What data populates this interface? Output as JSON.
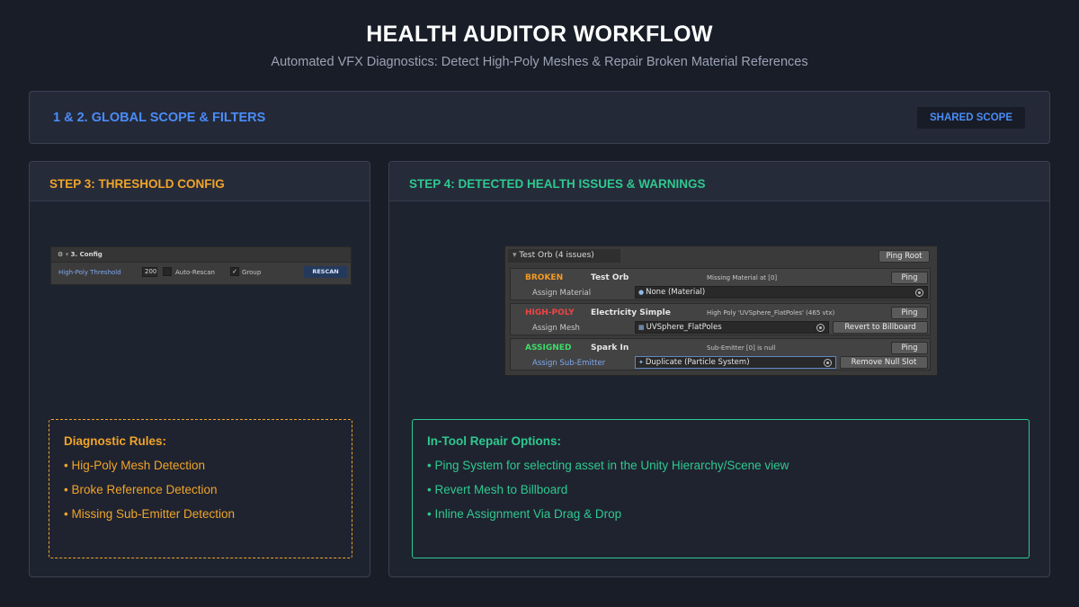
{
  "header": {
    "title": "HEALTH AUDITOR WORKFLOW",
    "subtitle": "Automated VFX Diagnostics: Detect High-Poly Meshes & Repair Broken Material References"
  },
  "scope": {
    "title": "1 & 2. GLOBAL SCOPE & FILTERS",
    "button": "SHARED SCOPE"
  },
  "step3": {
    "title": "STEP 3: THRESHOLD CONFIG",
    "config": {
      "header": "3. Config",
      "threshold_label": "High-Poly Threshold",
      "threshold_value": "200",
      "auto_rescan_label": "Auto-Rescan",
      "auto_rescan_checked": false,
      "group_label": "Group",
      "group_checked": true,
      "check_mark": "✓",
      "rescan_button": "RESCAN"
    },
    "rules": {
      "title": "Diagnostic Rules:",
      "items": [
        "• Hig-Poly Mesh Detection",
        "• Broke Reference Detection",
        "• Missing Sub-Emitter Detection"
      ]
    }
  },
  "step4": {
    "title": "STEP 4: DETECTED HEALTH ISSUES & WARNINGS",
    "inspector": {
      "header": "Test Orb (4 issues)",
      "ping_root": "Ping Root",
      "issues": [
        {
          "status": "BROKEN",
          "status_color": "#f59a23",
          "name": "Test Orb",
          "description": "Missing Material at [0]",
          "ping": "Ping",
          "assign_label": "Assign Material",
          "assign_label_color": "#c8c8c8",
          "field_icon": "●",
          "field_value": "None (Material)",
          "action": ""
        },
        {
          "status": "HIGH-POLY",
          "status_color": "#ef4444",
          "name": "Electricity Simple",
          "description": "High Poly 'UVSphere_FlatPoles' (465 vtx)",
          "ping": "Ping",
          "assign_label": "Assign Mesh",
          "assign_label_color": "#c8c8c8",
          "field_icon": "▦",
          "field_value": "UVSphere_FlatPoles",
          "action": "Revert to Billboard"
        },
        {
          "status": "ASSIGNED",
          "status_color": "#3ddc6a",
          "name": "Spark In",
          "description": "Sub-Emitter [0] is null",
          "ping": "Ping",
          "assign_label": "Assign Sub-Emitter",
          "assign_label_color": "#7fa7ee",
          "field_icon": "✦",
          "field_value": "Duplicate (Particle System)",
          "action": "Remove Null Slot"
        }
      ]
    },
    "repair": {
      "title": "In-Tool Repair Options:",
      "items": [
        "• Ping System for selecting asset in the Unity Hierarchy/Scene view",
        "• Revert Mesh to Billboard",
        "• Inline Assignment Via Drag & Drop"
      ]
    }
  }
}
